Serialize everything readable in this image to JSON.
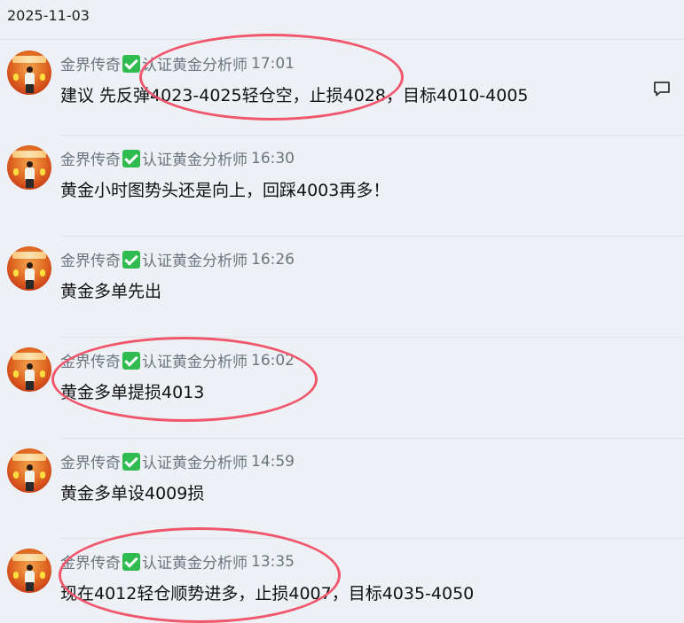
{
  "date": "2025-11-03",
  "sender_name": "金界传奇",
  "sender_role": "认证黄金分析师",
  "colors": {
    "background": "#edf1f5",
    "verified": "#2fbb4f",
    "highlight_ring": "#f0576c"
  },
  "messages": [
    {
      "time": "17:01",
      "text": "建议 先反弹4023-4025轻仓空，止损4028，目标4010-4005"
    },
    {
      "time": "16:30",
      "text": "黄金小时图势头还是向上，回踩4003再多！"
    },
    {
      "time": "16:26",
      "text": "黄金多单先出"
    },
    {
      "time": "16:02",
      "text": "黄金多单提损4013"
    },
    {
      "time": "14:59",
      "text": "黄金多单设4009损"
    },
    {
      "time": "13:35",
      "text": "现在4012轻仓顺势进多，止损4007，目标4035-4050"
    }
  ],
  "icons": {
    "reply": "comment-icon",
    "verified": "verified-check-icon"
  }
}
